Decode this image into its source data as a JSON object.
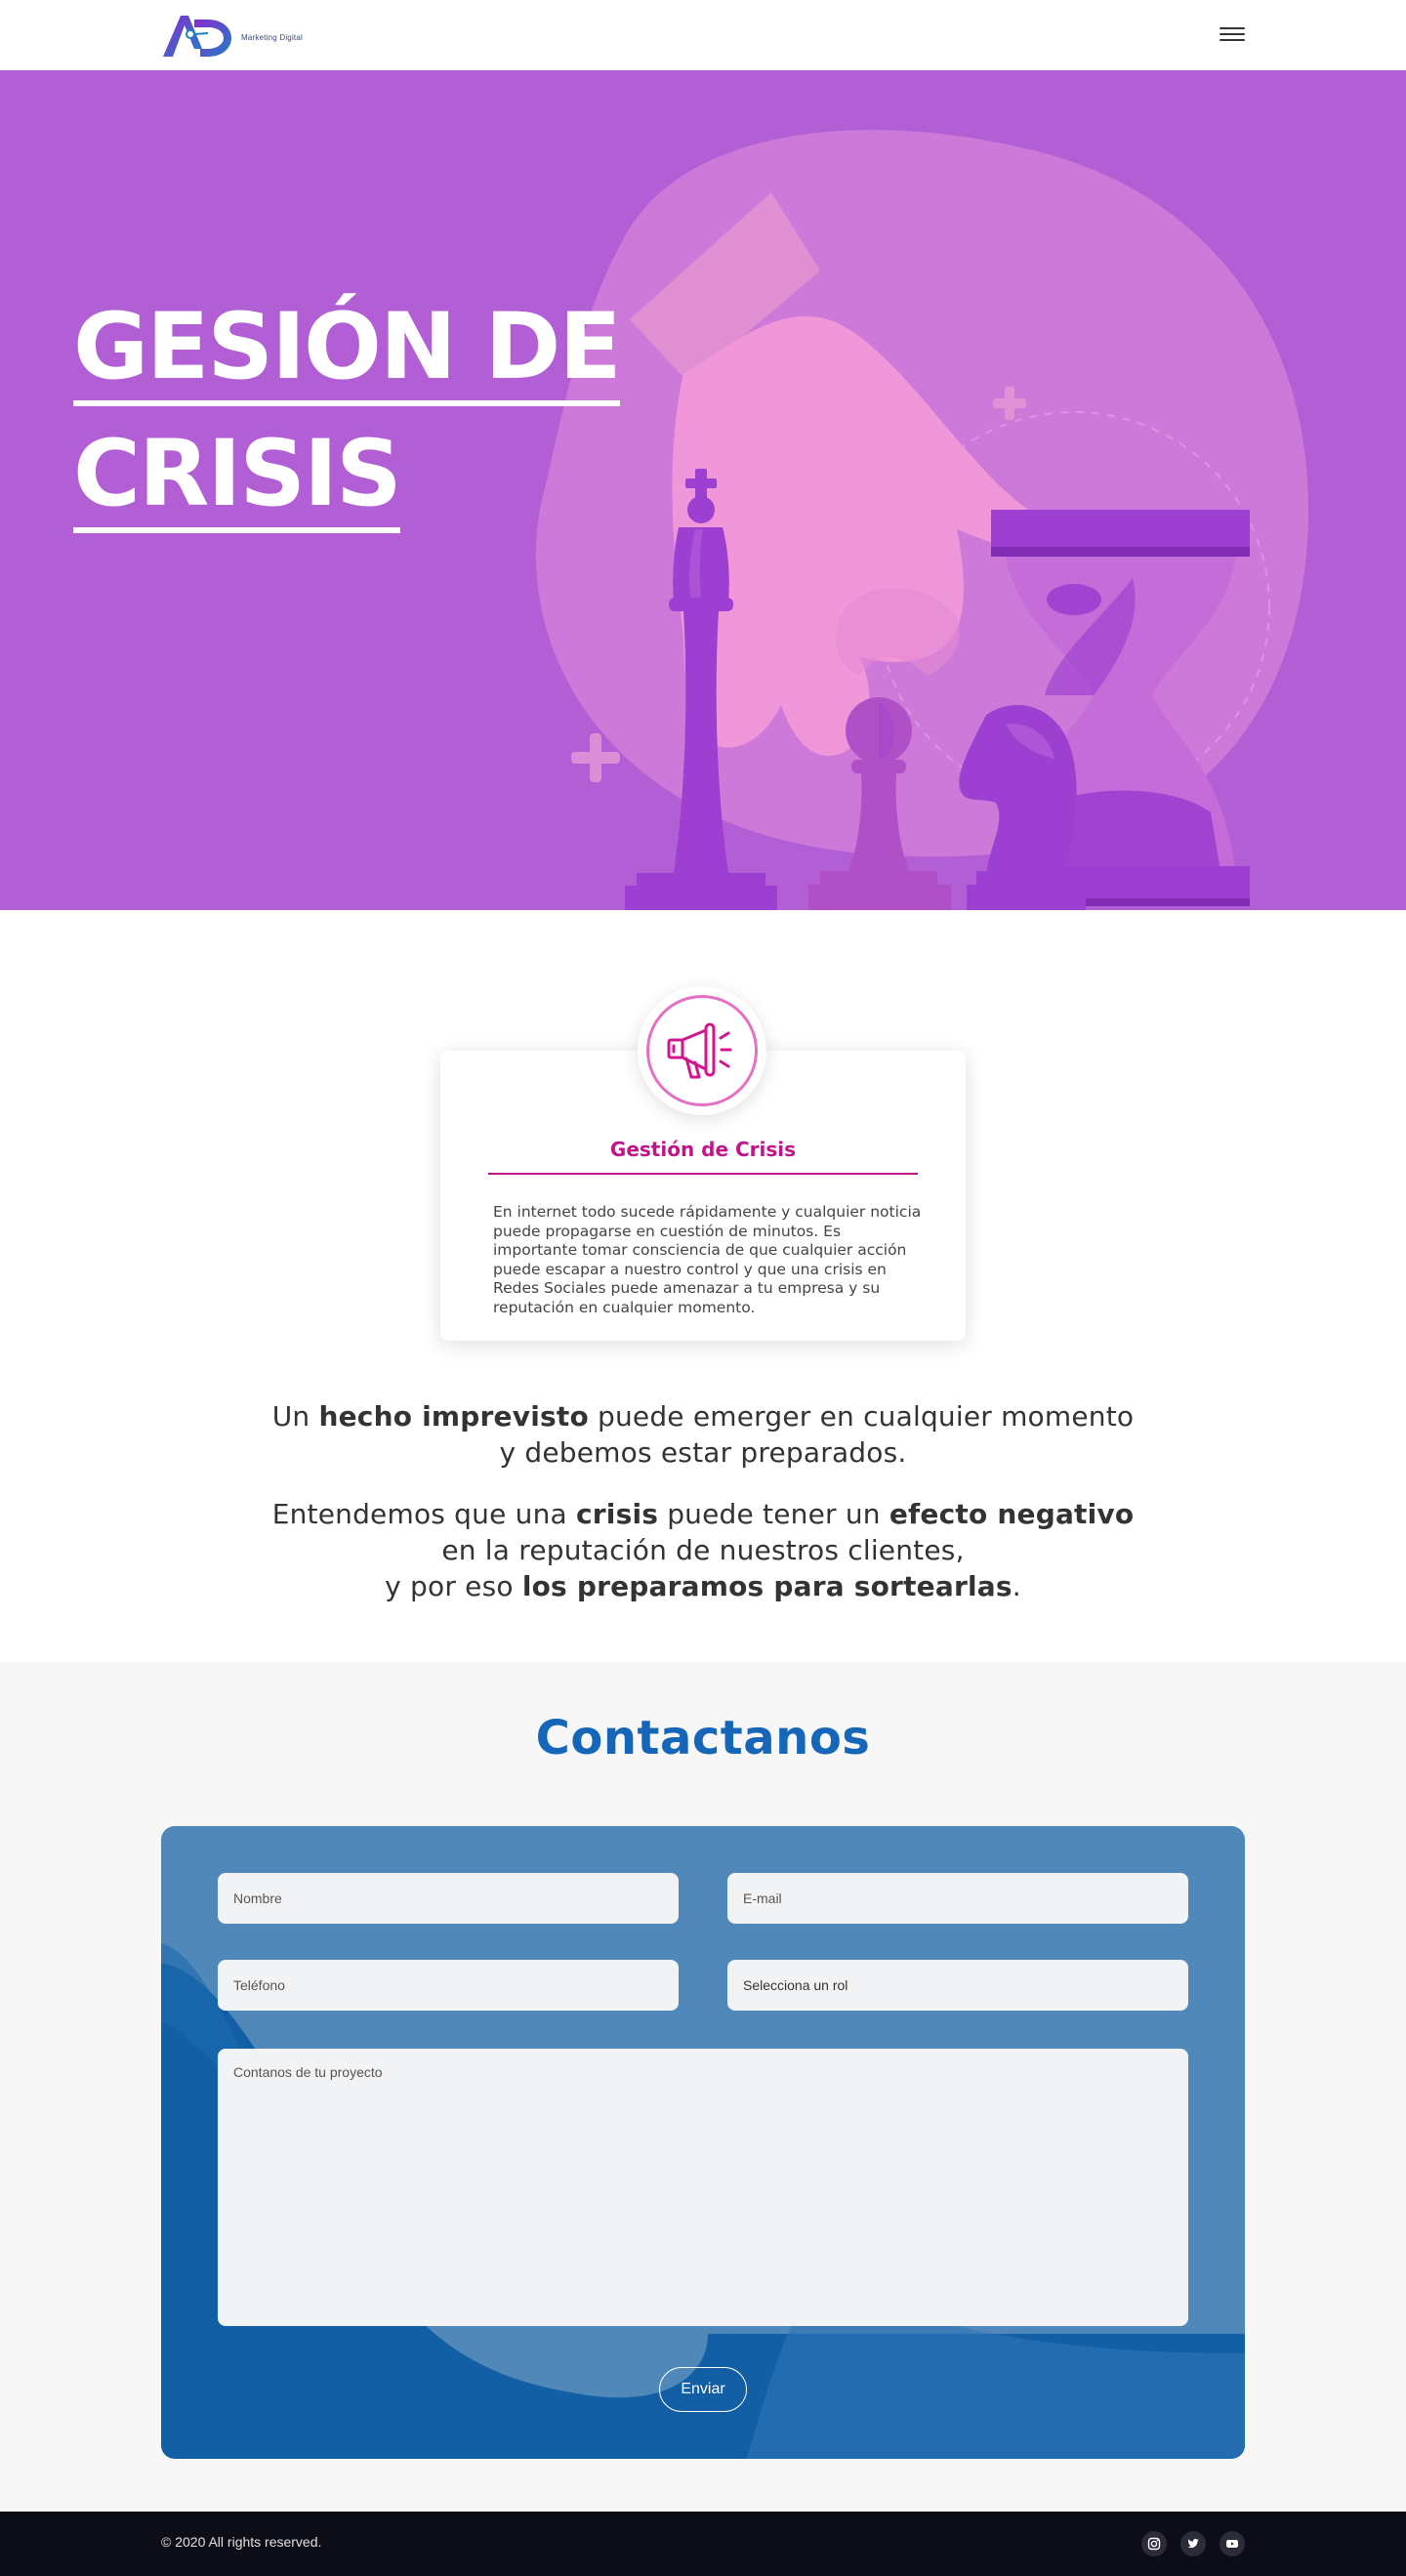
{
  "header": {
    "logo_letters": "AD",
    "logo_text": "Marketing Digital",
    "menu_icon": "hamburger-icon"
  },
  "hero": {
    "title_line1": "GESIÓN DE",
    "title_line2": "CRISIS",
    "background_color": "#b25fd6"
  },
  "service_card": {
    "icon": "megaphone-icon",
    "title": "Gestión de Crisis",
    "text": "En internet todo sucede rápidamente y cualquier noticia puede propagarse en cuestión de minutos. Es importante tomar consciencia de que cualquier acción puede escapar a nuestro control y que una crisis en Redes Sociales puede amenazar a tu empresa y su reputación en cualquier momento.",
    "accent_color": "#c0148a"
  },
  "intro": {
    "p1": {
      "a": "Un ",
      "b": "hecho imprevisto",
      "c": " puede emerger en cualquier momento",
      "d": "y debemos estar preparados."
    },
    "p2": {
      "a": "Entendemos que una ",
      "b": "crisis",
      "c": " puede tener un ",
      "d": "efecto negativo",
      "e": "en la reputación de nuestros clientes,",
      "f": "y por eso ",
      "g": "los preparamos para sortearlas",
      "h": "."
    }
  },
  "contact": {
    "title": "Contactanos",
    "fields": {
      "nombre": "Nombre",
      "email": "E-mail",
      "telefono": "Teléfono",
      "rol": "Selecciona un rol",
      "mensaje": "Contanos de tu proyecto"
    },
    "submit": "Enviar",
    "title_color": "#1565b8"
  },
  "footer": {
    "copyright": "© 2020 All rights reserved.",
    "social_icons": [
      "instagram-icon",
      "twitter-icon",
      "youtube-icon"
    ]
  }
}
